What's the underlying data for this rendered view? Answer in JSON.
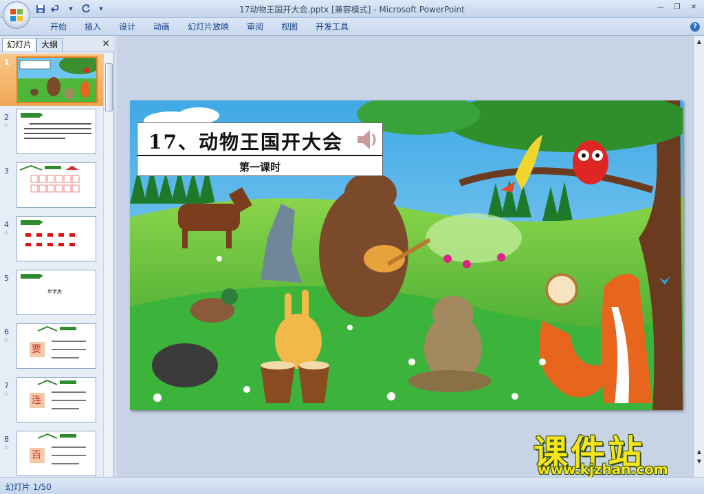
{
  "window": {
    "title": "17动物王国开大会.pptx [兼容模式] - Microsoft PowerPoint"
  },
  "ribbon": {
    "tabs": [
      "开始",
      "插入",
      "设计",
      "动画",
      "幻灯片放映",
      "审阅",
      "视图",
      "开发工具"
    ]
  },
  "panel": {
    "tab_slides": "幻灯片",
    "tab_outline": "大纲",
    "thumbnails": [
      {
        "num": "1",
        "selected": true
      },
      {
        "num": "2"
      },
      {
        "num": "3"
      },
      {
        "num": "4"
      },
      {
        "num": "5",
        "text": "年字房"
      },
      {
        "num": "6",
        "char": "要"
      },
      {
        "num": "7",
        "char": "连"
      },
      {
        "num": "8",
        "char": "百"
      }
    ]
  },
  "slide": {
    "title": "17、动物王国开大会",
    "subtitle": "第一课时"
  },
  "watermark": {
    "brand": "课件站",
    "url": "www.kjzhan.com"
  },
  "status": {
    "slide_counter": "幻灯片 1/50"
  },
  "colors": {
    "accent": "#15428b",
    "selection": "#f0a657",
    "watermark": "#f6e51a"
  }
}
